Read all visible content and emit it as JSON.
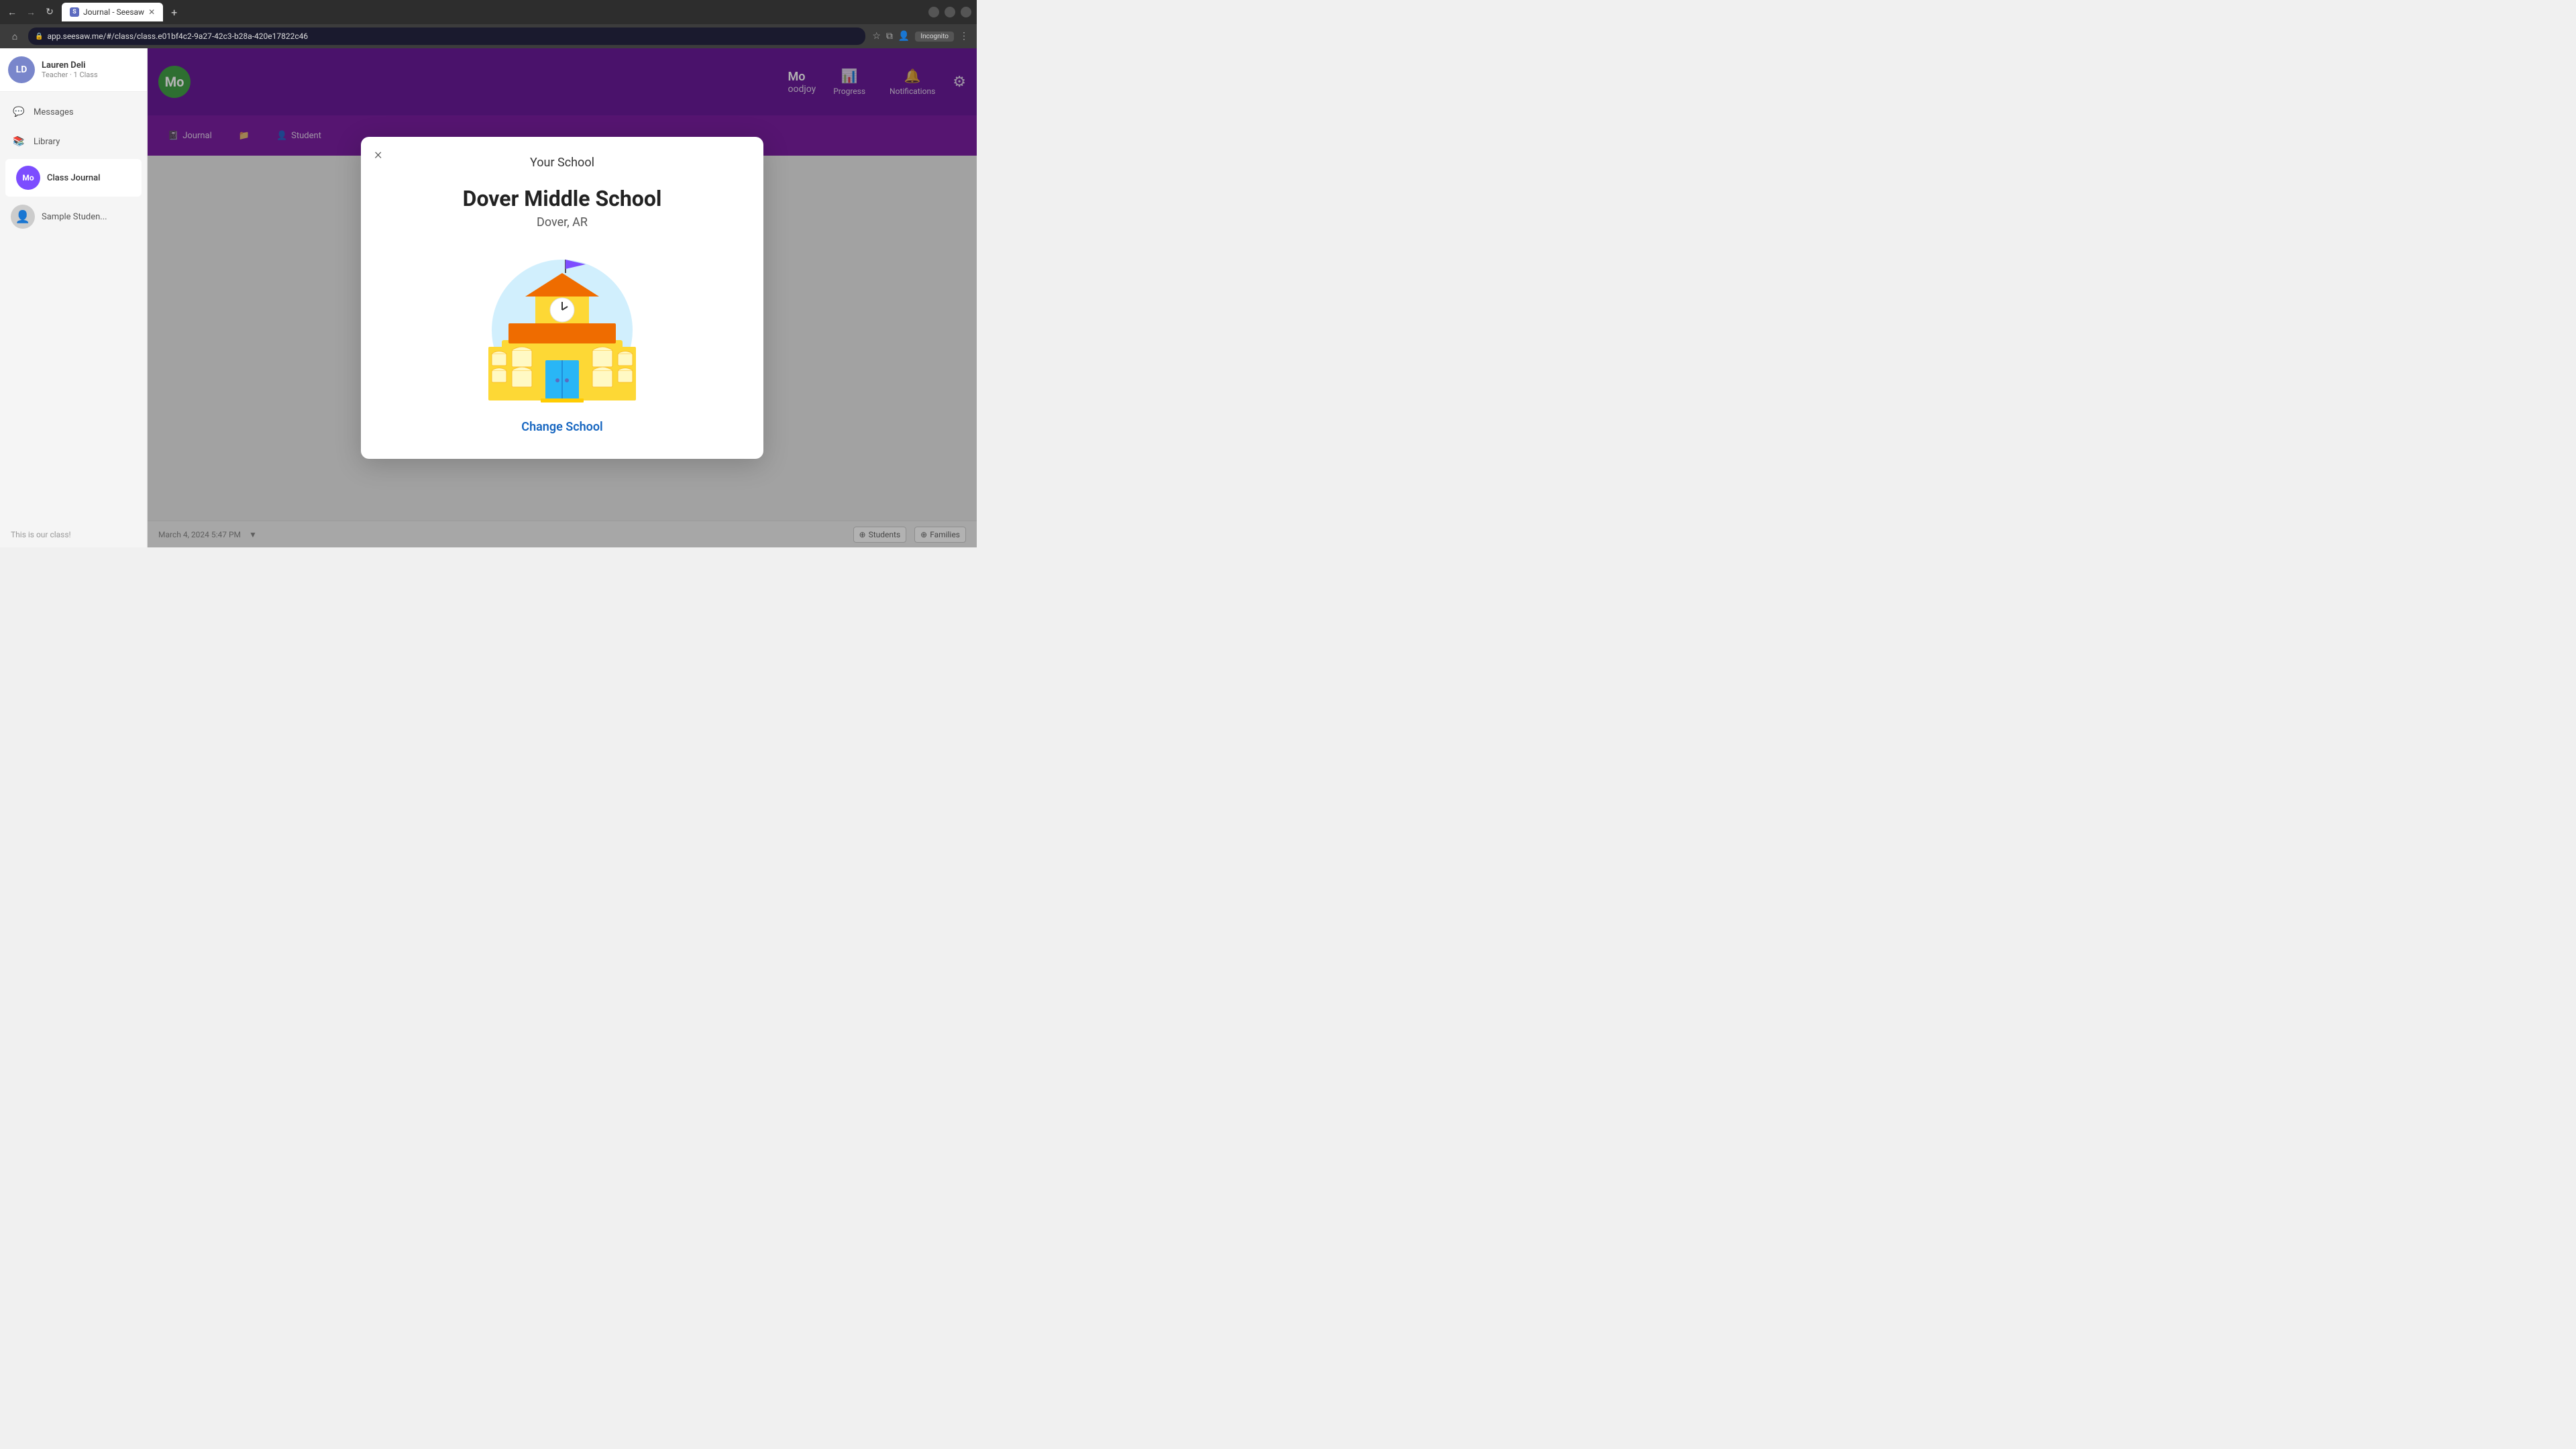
{
  "browser": {
    "tab_title": "Journal - Seesaw",
    "tab_favicon": "S",
    "url": "app.seesaw.me/#/class/class.e01bf4c2-9a27-42c3-b28a-420e17822c46",
    "incognito_label": "Incognito"
  },
  "sidebar": {
    "user_name": "Lauren Deli",
    "user_role": "Teacher · 1 Class",
    "user_initials": "LD",
    "messages_label": "Messages",
    "library_label": "Library",
    "class_journal_label": "Class Journal",
    "class_journal_initials": "Mo",
    "sample_student_label": "Sample Studen..."
  },
  "top_nav": {
    "logo_letter": "Mo",
    "profile_name": "Mo",
    "profile_subtitle": "oodjoy",
    "progress_label": "Progress",
    "notifications_label": "Notifications",
    "settings_icon": "⚙"
  },
  "secondary_nav": {
    "journal_label": "Journal",
    "student_label": "Student"
  },
  "page": {
    "title": "8 Journal Seesaw",
    "footer_text": "This is our class!",
    "date_label": "March 4, 2024 5:47 PM",
    "students_label": "Students",
    "families_label": "Families"
  },
  "modal": {
    "title": "Your School",
    "school_name": "Dover Middle School",
    "school_location": "Dover, AR",
    "close_icon": "×",
    "change_school_label": "Change School"
  }
}
